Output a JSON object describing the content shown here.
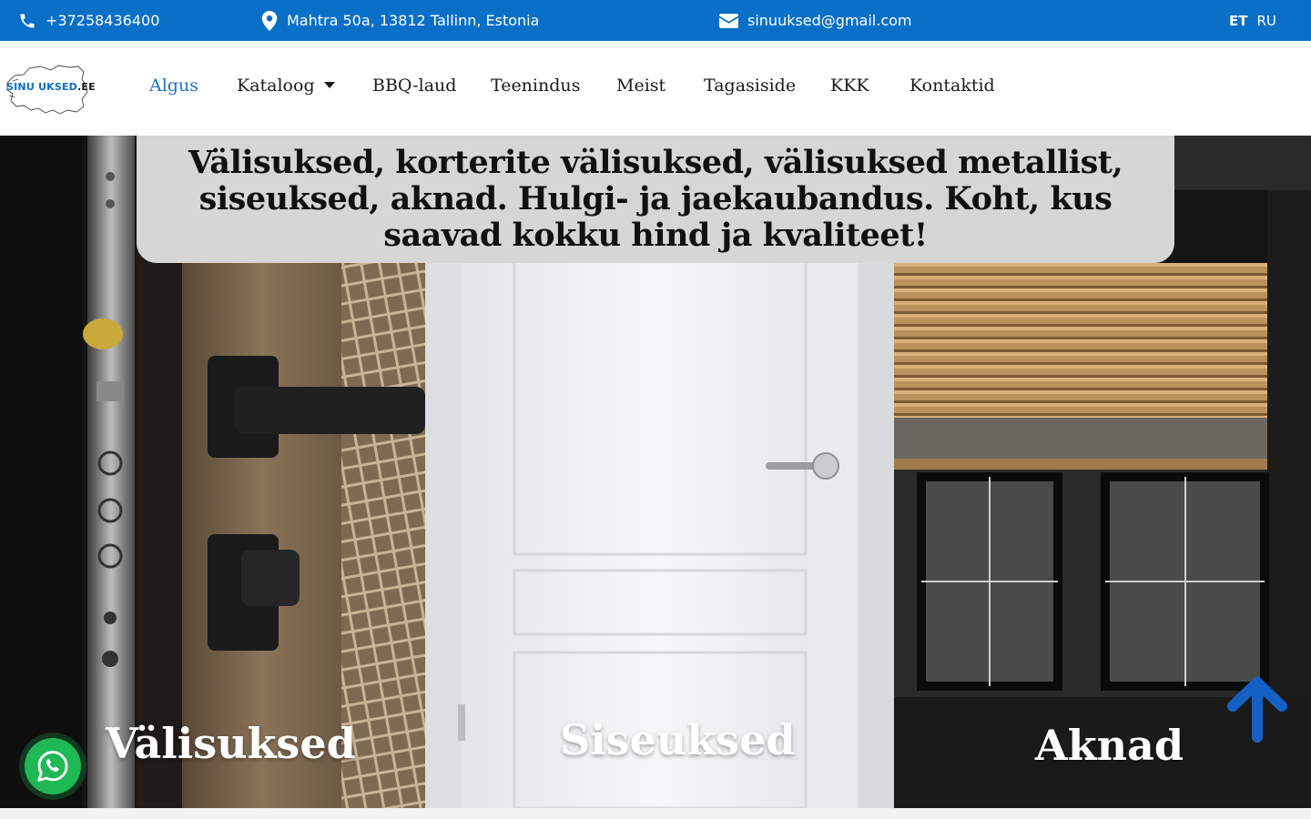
{
  "topbar": {
    "phone": "+37258436400",
    "address": "Mahtra 50a, 13812 Tallinn, Estonia",
    "email": "sinuuksed@gmail.com",
    "languages": [
      {
        "code": "ET",
        "active": true
      },
      {
        "code": "RU",
        "active": false
      }
    ]
  },
  "logo": {
    "part1": "SINU UKSED",
    "part2": ".EE"
  },
  "nav": {
    "items": [
      {
        "label": "Algus",
        "active": true
      },
      {
        "label": "Kataloog",
        "has_dropdown": true
      },
      {
        "label": "BBQ-laud"
      },
      {
        "label": "Teenindus"
      },
      {
        "label": "Meist"
      },
      {
        "label": "Tagasiside"
      },
      {
        "label": "KKK"
      },
      {
        "label": "Kontaktid"
      }
    ]
  },
  "hero": {
    "headline": "Välisuksed, korterite välisuksed, välisuksed metallist, siseuksed, aknad. Hulgi- ja jaekaubandus. Koht, kus saavad kokku hind ja kvaliteet!",
    "panels": [
      {
        "label": "Välisuksed"
      },
      {
        "label": "Siseuksed"
      },
      {
        "label": "Aknad"
      }
    ]
  },
  "colors": {
    "topbar_bg": "#0a6fc7",
    "nav_active": "#1b73c9",
    "headline_box": "#d6d6d6",
    "whatsapp": "#1fb855",
    "scroll_arrow": "#1560c4"
  },
  "icons": {
    "phone": "phone-icon",
    "address": "map-pin-icon",
    "email": "envelope-icon",
    "whatsapp": "whatsapp-icon",
    "scroll_top": "arrow-up-icon"
  }
}
